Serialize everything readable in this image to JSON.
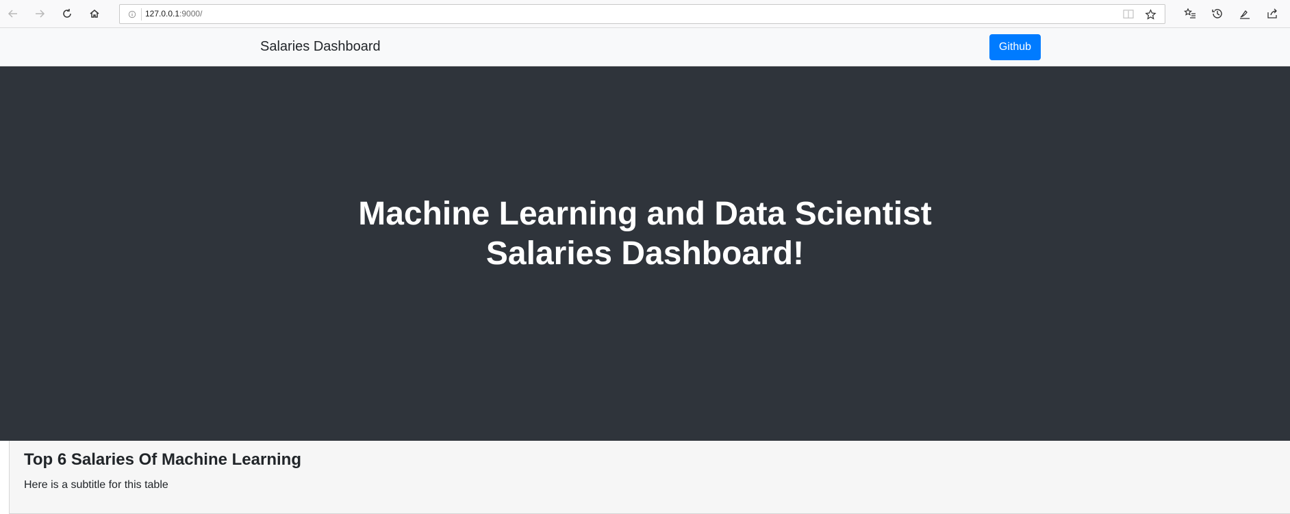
{
  "browser": {
    "url_host": "127.0.0.1",
    "url_rest": ":9000/",
    "icons": [
      "back-arrow-icon",
      "forward-arrow-icon",
      "reload-icon",
      "home-icon",
      "info-icon",
      "reader-view-icon",
      "star-icon",
      "favorites-icon",
      "history-icon",
      "pen-icon",
      "share-icon"
    ]
  },
  "navbar": {
    "brand": "Salaries Dashboard",
    "github_label": "Github",
    "github_color": "#007bff"
  },
  "hero": {
    "title_line1": "Machine Learning and Data Scientist",
    "title_line2": "Salaries Dashboard!",
    "background": "#2f343b"
  },
  "table_card": {
    "title": "Top 6 Salaries Of Machine Learning",
    "subtitle": "Here is a subtitle for this table"
  }
}
